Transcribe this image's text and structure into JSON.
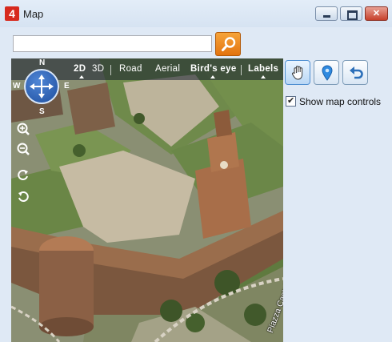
{
  "window": {
    "app_icon_label": "4",
    "title": "Map"
  },
  "search": {
    "value": "",
    "placeholder": ""
  },
  "map": {
    "view_modes": [
      "2D",
      "3D"
    ],
    "styles": [
      "Road",
      "Aerial",
      "Bird's eye",
      "Labels"
    ],
    "active_style": "Bird's eye",
    "compass": {
      "north": "N",
      "south": "S",
      "east": "E",
      "west": "W"
    },
    "street_label": "Piazza Castello"
  },
  "tools": {
    "pan": "hand-icon",
    "pin": "location-pin-icon",
    "undo": "undo-icon"
  },
  "options": {
    "show_map_controls_label": "Show map controls",
    "show_map_controls": true
  },
  "colors": {
    "accent_orange": "#e3740f",
    "close_red": "#c7402b",
    "compass_blue": "#1e4e9e"
  }
}
